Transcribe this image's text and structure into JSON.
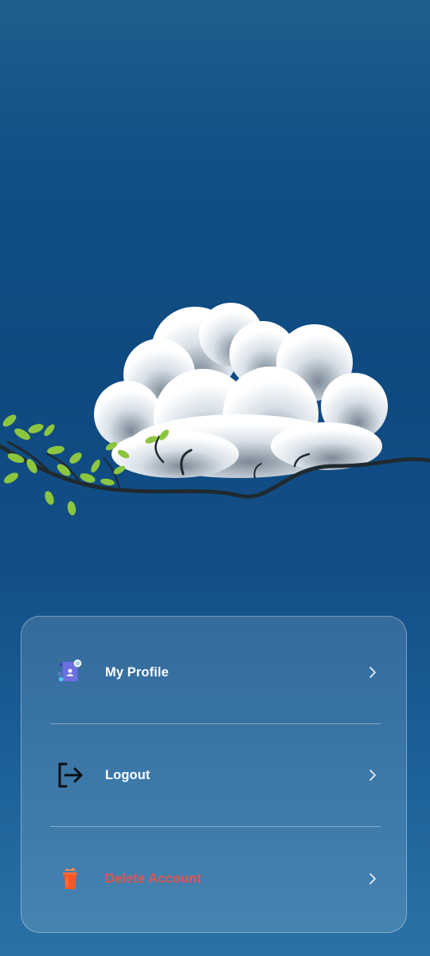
{
  "menu": {
    "items": [
      {
        "label": "My Profile",
        "icon": "profile-document-icon",
        "color": "#ffffff"
      },
      {
        "label": "Logout",
        "icon": "logout-icon",
        "color": "#ffffff"
      },
      {
        "label": "Delete Account",
        "icon": "trash-icon",
        "color": "#e5534b"
      }
    ]
  }
}
